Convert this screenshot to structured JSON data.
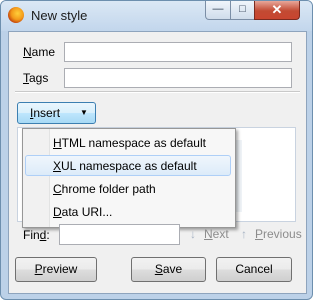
{
  "window": {
    "title": "New style"
  },
  "titlebar": {
    "minimize_glyph": "—",
    "maximize_glyph": "□",
    "close_glyph": "✕"
  },
  "form": {
    "name_label_accel": "N",
    "name_label_rest": "ame",
    "name_value": "",
    "tags_label_accel": "T",
    "tags_label_rest": "ags",
    "tags_value": ""
  },
  "insert": {
    "label_accel": "I",
    "label_rest": "nsert",
    "arrow_glyph": "▼",
    "menu": [
      {
        "accel": "H",
        "rest": "TML namespace as default",
        "highlighted": false
      },
      {
        "accel": "X",
        "rest": "UL namespace as default",
        "highlighted": true
      },
      {
        "accel": "C",
        "rest": "hrome folder path",
        "highlighted": false
      },
      {
        "accel": "D",
        "rest": "ata URI...",
        "highlighted": false
      }
    ]
  },
  "find": {
    "label_pre": "Fin",
    "label_accel": "d",
    "label_post": ":",
    "value": "",
    "next_accel": "N",
    "next_rest": "ext",
    "previous_accel": "P",
    "previous_rest": "revious",
    "down_arrow": "↓",
    "up_arrow": "↑"
  },
  "buttons": {
    "preview_accel": "P",
    "preview_rest": "review",
    "save_accel": "S",
    "save_rest": "ave",
    "cancel": "Cancel"
  }
}
